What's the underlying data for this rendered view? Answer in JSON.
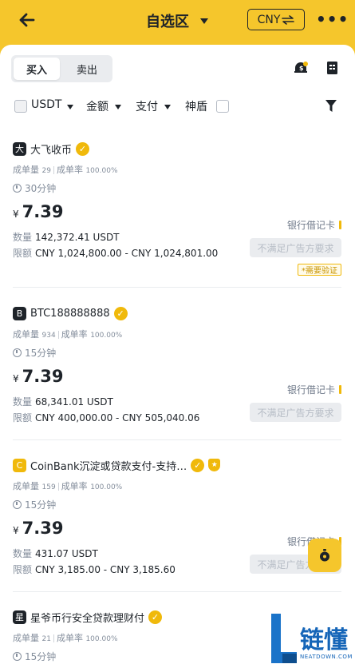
{
  "header": {
    "back_icon": "arrow-left-icon",
    "title": "自选区",
    "currency_label": "CNY",
    "currency_swap_icon": "swap-icon",
    "more_icon": "more-dots-icon",
    "bg_color": "#F5C62C"
  },
  "tabs": {
    "buy": "买入",
    "sell": "卖出",
    "active": "buy"
  },
  "top_icons": [
    "ad-fee-icon",
    "orders-icon"
  ],
  "filters": {
    "asset": "USDT",
    "amount": "金额",
    "payment": "支付",
    "shield": "神盾",
    "filter_icon": "filter-icon"
  },
  "listings": [
    {
      "avatar": "大",
      "name": "大飞收币",
      "verified": true,
      "shield": false,
      "orders_label": "成单量",
      "orders": "29",
      "rate_label": "成单率",
      "rate": "100.00%",
      "time": "30分钟",
      "currency_symbol": "¥",
      "price": "7.39",
      "qty_label": "数量",
      "qty": "142,372.41 USDT",
      "limit_label": "限额",
      "limit": "CNY 1,024,800.00 - CNY 1,024,801.00",
      "payment": "银行借记卡",
      "cta": "不满足广告方要求",
      "tag": "*需要验证"
    },
    {
      "avatar": "B",
      "name": "BTC188888888",
      "verified": true,
      "shield": false,
      "orders_label": "成单量",
      "orders": "934",
      "rate_label": "成单率",
      "rate": "100.00%",
      "time": "15分钟",
      "currency_symbol": "¥",
      "price": "7.39",
      "qty_label": "数量",
      "qty": "68,341.01 USDT",
      "limit_label": "限额",
      "limit": "CNY 400,000.00 - CNY 505,040.06",
      "payment": "银行借记卡",
      "cta": "不满足广告方要求",
      "tag": ""
    },
    {
      "avatar": "C",
      "name": "CoinBank沉淀或贷款支付-支持…",
      "verified": true,
      "shield": true,
      "orders_label": "成单量",
      "orders": "159",
      "rate_label": "成单率",
      "rate": "100.00%",
      "time": "15分钟",
      "currency_symbol": "¥",
      "price": "7.39",
      "qty_label": "数量",
      "qty": "431.07 USDT",
      "limit_label": "限额",
      "limit": "CNY 3,185.00 - CNY 3,185.60",
      "payment": "银行借记卡",
      "cta": "不满足广告方要求",
      "tag": ""
    },
    {
      "avatar": "星",
      "name": "星爷币行安全贷款理财付",
      "verified": true,
      "shield": false,
      "orders_label": "成单量",
      "orders": "21",
      "rate_label": "成单率",
      "rate": "100.00%",
      "time": "15分钟"
    }
  ],
  "watermark": {
    "letter": "L",
    "brand": "链懂",
    "site": "NEATDOWN.COM"
  }
}
